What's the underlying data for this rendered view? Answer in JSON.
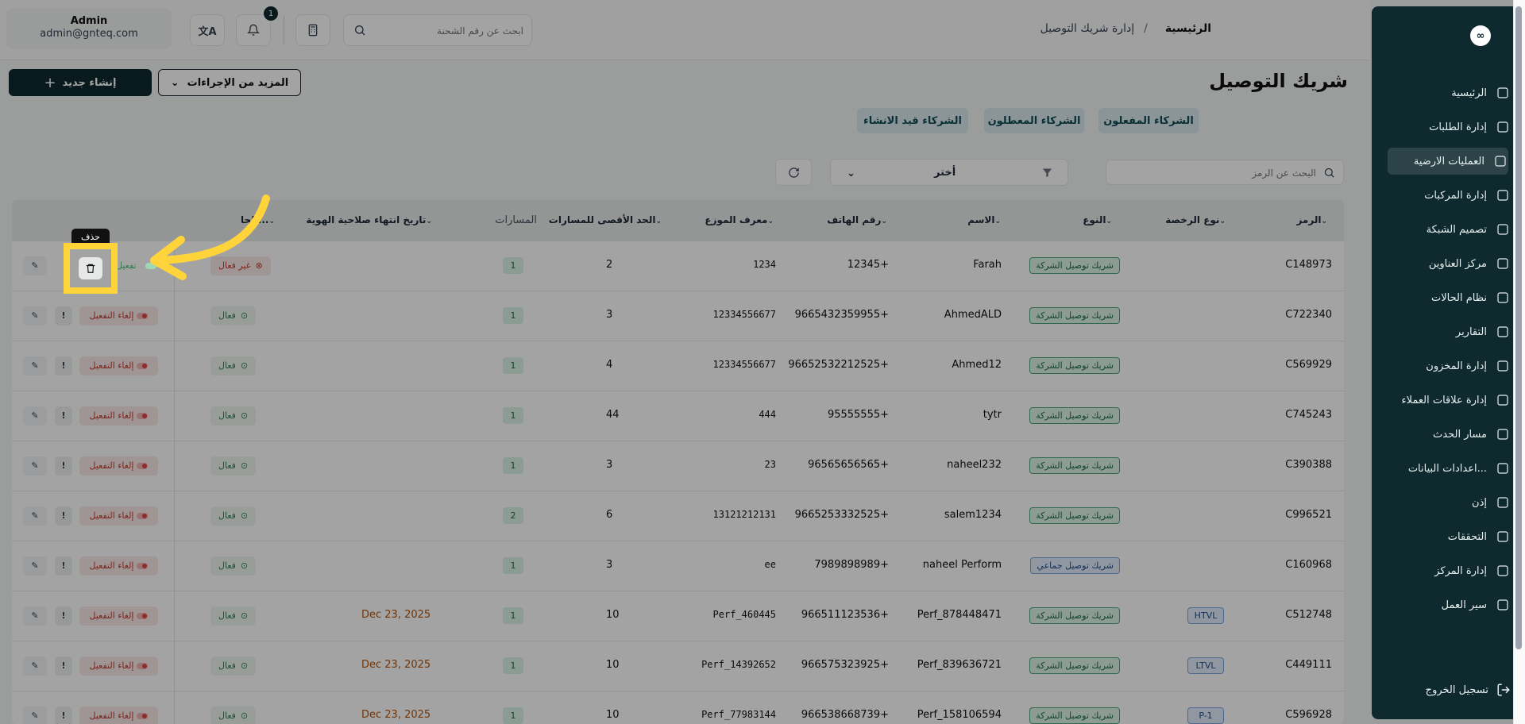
{
  "user": {
    "name": "Admin",
    "email": "admin@gnteq.com"
  },
  "notifications": {
    "count": "1"
  },
  "global_search": {
    "placeholder": "ابحث عن رقم الشحنة"
  },
  "breadcrumb": {
    "home": "الرئيسية",
    "separator": "/",
    "current": "إدارة شريك التوصيل"
  },
  "page": {
    "title": "شريك التوصيل",
    "create_button": "إنشاء جديد",
    "more_actions": "المزيد من الإجراءات"
  },
  "tabs": [
    {
      "label": "الشركاء المفعلون"
    },
    {
      "label": "الشركاء المعطلون"
    },
    {
      "label": "الشركاء قيد الانشاء"
    }
  ],
  "filters": {
    "search_placeholder": "البحث عن الرمز",
    "select_value": "أختر"
  },
  "table": {
    "columns": [
      "الرمز",
      "نوع الرخصة",
      "النوع",
      "الاسم",
      "رقم الهاتف",
      "معرف الموزع",
      "الحد الأقصى للمسارات",
      "المسارات",
      "تاريخ انتهاء صلاحية الهوية",
      "الحا..."
    ],
    "rows": [
      {
        "code": "C148973",
        "license": "",
        "type": "شريك توصيل الشركة",
        "type_style": "green",
        "name": "Farah",
        "phone": "12345+",
        "distributor": "1234",
        "max_paths": "2",
        "paths": "1",
        "expiry": "",
        "status": "غير فعال",
        "status_style": "bad",
        "action": "تفعيل"
      },
      {
        "code": "C722340",
        "license": "",
        "type": "شريك توصيل الشركة",
        "type_style": "green",
        "name": "AhmedALD",
        "phone": "9665432359955+",
        "distributor": "12334556677",
        "max_paths": "3",
        "paths": "1",
        "expiry": "",
        "status": "فعال",
        "status_style": "ok",
        "action": "إلغاء التفعيل"
      },
      {
        "code": "C569929",
        "license": "",
        "type": "شريك توصيل الشركة",
        "type_style": "green",
        "name": "Ahmed12",
        "phone": "96652532212525+",
        "distributor": "12334556677",
        "max_paths": "4",
        "paths": "1",
        "expiry": "",
        "status": "فعال",
        "status_style": "ok",
        "action": "إلغاء التفعيل"
      },
      {
        "code": "C745243",
        "license": "",
        "type": "شريك توصيل الشركة",
        "type_style": "green",
        "name": "tytr",
        "phone": "95555555+",
        "distributor": "444",
        "max_paths": "44",
        "paths": "1",
        "expiry": "",
        "status": "فعال",
        "status_style": "ok",
        "action": "إلغاء التفعيل"
      },
      {
        "code": "C390388",
        "license": "",
        "type": "شريك توصيل الشركة",
        "type_style": "green",
        "name": "naheel232",
        "phone": "96565656565+",
        "distributor": "23",
        "max_paths": "3",
        "paths": "1",
        "expiry": "",
        "status": "فعال",
        "status_style": "ok",
        "action": "إلغاء التفعيل"
      },
      {
        "code": "C996521",
        "license": "",
        "type": "شريك توصيل الشركة",
        "type_style": "green",
        "name": "salem1234",
        "phone": "9665253332525+",
        "distributor": "13121212131",
        "max_paths": "6",
        "paths": "2",
        "expiry": "",
        "status": "فعال",
        "status_style": "ok",
        "action": "إلغاء التفعيل"
      },
      {
        "code": "C160968",
        "license": "",
        "type": "شريك توصيل جماعي",
        "type_style": "blue",
        "name": "naheel Perform",
        "phone": "7989898989+",
        "distributor": "ee",
        "max_paths": "3",
        "paths": "1",
        "expiry": "",
        "status": "فعال",
        "status_style": "ok",
        "action": "إلغاء التفعيل"
      },
      {
        "code": "C512748",
        "license": "HTVL",
        "type": "شريك توصيل الشركة",
        "type_style": "green",
        "name": "Perf_878448471",
        "phone": "966511123536+",
        "distributor": "Perf_460445",
        "max_paths": "10",
        "paths": "1",
        "expiry": "Dec 23, 2025",
        "status": "فعال",
        "status_style": "ok",
        "action": "إلغاء التفعيل"
      },
      {
        "code": "C449111",
        "license": "LTVL",
        "type": "شريك توصيل الشركة",
        "type_style": "green",
        "name": "Perf_839636721",
        "phone": "966575323925+",
        "distributor": "Perf_14392652",
        "max_paths": "10",
        "paths": "1",
        "expiry": "Dec 23, 2025",
        "status": "فعال",
        "status_style": "ok",
        "action": "إلغاء التفعيل"
      },
      {
        "code": "C596928",
        "license": "P-1",
        "type": "شريك توصيل الشركة",
        "type_style": "green",
        "name": "Perf_158106594",
        "phone": "966538668739+",
        "distributor": "Perf_77983144",
        "max_paths": "10",
        "paths": "1",
        "expiry": "Dec 23, 2025",
        "status": "فعال",
        "status_style": "ok",
        "action": "إلغاء التفعيل"
      }
    ]
  },
  "tooltip": {
    "delete": "حذف"
  },
  "sidebar": {
    "logo": "∞",
    "items": [
      {
        "label": "الرئيسية",
        "icon": "dashboard-icon"
      },
      {
        "label": "إدارة الطلبات",
        "icon": "orders-icon"
      },
      {
        "label": "العمليات الارضية",
        "icon": "ground-ops-icon"
      },
      {
        "label": "إدارة المركبات",
        "icon": "truck-icon"
      },
      {
        "label": "تصميم الشبكة",
        "icon": "network-icon"
      },
      {
        "label": "مركز العناوين",
        "icon": "location-icon"
      },
      {
        "label": "نظام الحالات",
        "icon": "status-icon"
      },
      {
        "label": "التقارير",
        "icon": "reports-icon"
      },
      {
        "label": "إدارة المخزون",
        "icon": "inventory-icon"
      },
      {
        "label": "إدارة علاقات العملاء",
        "icon": "crm-icon"
      },
      {
        "label": "مسار الحدث",
        "icon": "route-icon"
      },
      {
        "label": "اعدادات البيانات...",
        "icon": "database-icon"
      },
      {
        "label": "إذن",
        "icon": "users-icon"
      },
      {
        "label": "التحققات",
        "icon": "tools-icon"
      },
      {
        "label": "إدارة المركز",
        "icon": "center-icon"
      },
      {
        "label": "سير العمل",
        "icon": "workflow-icon"
      }
    ],
    "logout": "تسجيل الخروج"
  }
}
